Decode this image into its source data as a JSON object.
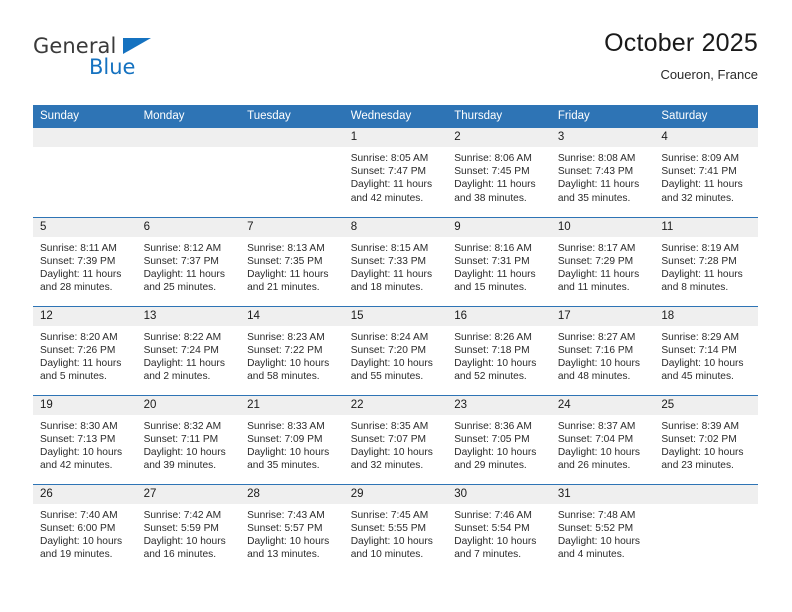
{
  "logo": {
    "word_one": "General",
    "word_two": "Blue",
    "flag_icon": "triangle-flag-icon",
    "accent_color": "#1572c0"
  },
  "header": {
    "title": "October 2025",
    "subtitle": "Coueron, France"
  },
  "theme": {
    "header_blue": "#2e74b5",
    "daynum_bg": "#efefef",
    "text": "#2b2b2b"
  },
  "calendar": {
    "weekday_headers": [
      "Sunday",
      "Monday",
      "Tuesday",
      "Wednesday",
      "Thursday",
      "Friday",
      "Saturday"
    ],
    "weeks": [
      [
        {
          "day": "",
          "blank": true,
          "sunrise": "",
          "sunset": "",
          "daylight_line1": "",
          "daylight_line2": ""
        },
        {
          "day": "",
          "blank": true,
          "sunrise": "",
          "sunset": "",
          "daylight_line1": "",
          "daylight_line2": ""
        },
        {
          "day": "",
          "blank": true,
          "sunrise": "",
          "sunset": "",
          "daylight_line1": "",
          "daylight_line2": ""
        },
        {
          "day": "1",
          "blank": false,
          "sunrise": "Sunrise: 8:05 AM",
          "sunset": "Sunset: 7:47 PM",
          "daylight_line1": "Daylight: 11 hours",
          "daylight_line2": "and 42 minutes."
        },
        {
          "day": "2",
          "blank": false,
          "sunrise": "Sunrise: 8:06 AM",
          "sunset": "Sunset: 7:45 PM",
          "daylight_line1": "Daylight: 11 hours",
          "daylight_line2": "and 38 minutes."
        },
        {
          "day": "3",
          "blank": false,
          "sunrise": "Sunrise: 8:08 AM",
          "sunset": "Sunset: 7:43 PM",
          "daylight_line1": "Daylight: 11 hours",
          "daylight_line2": "and 35 minutes."
        },
        {
          "day": "4",
          "blank": false,
          "sunrise": "Sunrise: 8:09 AM",
          "sunset": "Sunset: 7:41 PM",
          "daylight_line1": "Daylight: 11 hours",
          "daylight_line2": "and 32 minutes."
        }
      ],
      [
        {
          "day": "5",
          "blank": false,
          "sunrise": "Sunrise: 8:11 AM",
          "sunset": "Sunset: 7:39 PM",
          "daylight_line1": "Daylight: 11 hours",
          "daylight_line2": "and 28 minutes."
        },
        {
          "day": "6",
          "blank": false,
          "sunrise": "Sunrise: 8:12 AM",
          "sunset": "Sunset: 7:37 PM",
          "daylight_line1": "Daylight: 11 hours",
          "daylight_line2": "and 25 minutes."
        },
        {
          "day": "7",
          "blank": false,
          "sunrise": "Sunrise: 8:13 AM",
          "sunset": "Sunset: 7:35 PM",
          "daylight_line1": "Daylight: 11 hours",
          "daylight_line2": "and 21 minutes."
        },
        {
          "day": "8",
          "blank": false,
          "sunrise": "Sunrise: 8:15 AM",
          "sunset": "Sunset: 7:33 PM",
          "daylight_line1": "Daylight: 11 hours",
          "daylight_line2": "and 18 minutes."
        },
        {
          "day": "9",
          "blank": false,
          "sunrise": "Sunrise: 8:16 AM",
          "sunset": "Sunset: 7:31 PM",
          "daylight_line1": "Daylight: 11 hours",
          "daylight_line2": "and 15 minutes."
        },
        {
          "day": "10",
          "blank": false,
          "sunrise": "Sunrise: 8:17 AM",
          "sunset": "Sunset: 7:29 PM",
          "daylight_line1": "Daylight: 11 hours",
          "daylight_line2": "and 11 minutes."
        },
        {
          "day": "11",
          "blank": false,
          "sunrise": "Sunrise: 8:19 AM",
          "sunset": "Sunset: 7:28 PM",
          "daylight_line1": "Daylight: 11 hours",
          "daylight_line2": "and 8 minutes."
        }
      ],
      [
        {
          "day": "12",
          "blank": false,
          "sunrise": "Sunrise: 8:20 AM",
          "sunset": "Sunset: 7:26 PM",
          "daylight_line1": "Daylight: 11 hours",
          "daylight_line2": "and 5 minutes."
        },
        {
          "day": "13",
          "blank": false,
          "sunrise": "Sunrise: 8:22 AM",
          "sunset": "Sunset: 7:24 PM",
          "daylight_line1": "Daylight: 11 hours",
          "daylight_line2": "and 2 minutes."
        },
        {
          "day": "14",
          "blank": false,
          "sunrise": "Sunrise: 8:23 AM",
          "sunset": "Sunset: 7:22 PM",
          "daylight_line1": "Daylight: 10 hours",
          "daylight_line2": "and 58 minutes."
        },
        {
          "day": "15",
          "blank": false,
          "sunrise": "Sunrise: 8:24 AM",
          "sunset": "Sunset: 7:20 PM",
          "daylight_line1": "Daylight: 10 hours",
          "daylight_line2": "and 55 minutes."
        },
        {
          "day": "16",
          "blank": false,
          "sunrise": "Sunrise: 8:26 AM",
          "sunset": "Sunset: 7:18 PM",
          "daylight_line1": "Daylight: 10 hours",
          "daylight_line2": "and 52 minutes."
        },
        {
          "day": "17",
          "blank": false,
          "sunrise": "Sunrise: 8:27 AM",
          "sunset": "Sunset: 7:16 PM",
          "daylight_line1": "Daylight: 10 hours",
          "daylight_line2": "and 48 minutes."
        },
        {
          "day": "18",
          "blank": false,
          "sunrise": "Sunrise: 8:29 AM",
          "sunset": "Sunset: 7:14 PM",
          "daylight_line1": "Daylight: 10 hours",
          "daylight_line2": "and 45 minutes."
        }
      ],
      [
        {
          "day": "19",
          "blank": false,
          "sunrise": "Sunrise: 8:30 AM",
          "sunset": "Sunset: 7:13 PM",
          "daylight_line1": "Daylight: 10 hours",
          "daylight_line2": "and 42 minutes."
        },
        {
          "day": "20",
          "blank": false,
          "sunrise": "Sunrise: 8:32 AM",
          "sunset": "Sunset: 7:11 PM",
          "daylight_line1": "Daylight: 10 hours",
          "daylight_line2": "and 39 minutes."
        },
        {
          "day": "21",
          "blank": false,
          "sunrise": "Sunrise: 8:33 AM",
          "sunset": "Sunset: 7:09 PM",
          "daylight_line1": "Daylight: 10 hours",
          "daylight_line2": "and 35 minutes."
        },
        {
          "day": "22",
          "blank": false,
          "sunrise": "Sunrise: 8:35 AM",
          "sunset": "Sunset: 7:07 PM",
          "daylight_line1": "Daylight: 10 hours",
          "daylight_line2": "and 32 minutes."
        },
        {
          "day": "23",
          "blank": false,
          "sunrise": "Sunrise: 8:36 AM",
          "sunset": "Sunset: 7:05 PM",
          "daylight_line1": "Daylight: 10 hours",
          "daylight_line2": "and 29 minutes."
        },
        {
          "day": "24",
          "blank": false,
          "sunrise": "Sunrise: 8:37 AM",
          "sunset": "Sunset: 7:04 PM",
          "daylight_line1": "Daylight: 10 hours",
          "daylight_line2": "and 26 minutes."
        },
        {
          "day": "25",
          "blank": false,
          "sunrise": "Sunrise: 8:39 AM",
          "sunset": "Sunset: 7:02 PM",
          "daylight_line1": "Daylight: 10 hours",
          "daylight_line2": "and 23 minutes."
        }
      ],
      [
        {
          "day": "26",
          "blank": false,
          "sunrise": "Sunrise: 7:40 AM",
          "sunset": "Sunset: 6:00 PM",
          "daylight_line1": "Daylight: 10 hours",
          "daylight_line2": "and 19 minutes."
        },
        {
          "day": "27",
          "blank": false,
          "sunrise": "Sunrise: 7:42 AM",
          "sunset": "Sunset: 5:59 PM",
          "daylight_line1": "Daylight: 10 hours",
          "daylight_line2": "and 16 minutes."
        },
        {
          "day": "28",
          "blank": false,
          "sunrise": "Sunrise: 7:43 AM",
          "sunset": "Sunset: 5:57 PM",
          "daylight_line1": "Daylight: 10 hours",
          "daylight_line2": "and 13 minutes."
        },
        {
          "day": "29",
          "blank": false,
          "sunrise": "Sunrise: 7:45 AM",
          "sunset": "Sunset: 5:55 PM",
          "daylight_line1": "Daylight: 10 hours",
          "daylight_line2": "and 10 minutes."
        },
        {
          "day": "30",
          "blank": false,
          "sunrise": "Sunrise: 7:46 AM",
          "sunset": "Sunset: 5:54 PM",
          "daylight_line1": "Daylight: 10 hours",
          "daylight_line2": "and 7 minutes."
        },
        {
          "day": "31",
          "blank": false,
          "sunrise": "Sunrise: 7:48 AM",
          "sunset": "Sunset: 5:52 PM",
          "daylight_line1": "Daylight: 10 hours",
          "daylight_line2": "and 4 minutes."
        },
        {
          "day": "",
          "blank": true,
          "sunrise": "",
          "sunset": "",
          "daylight_line1": "",
          "daylight_line2": ""
        }
      ]
    ]
  }
}
